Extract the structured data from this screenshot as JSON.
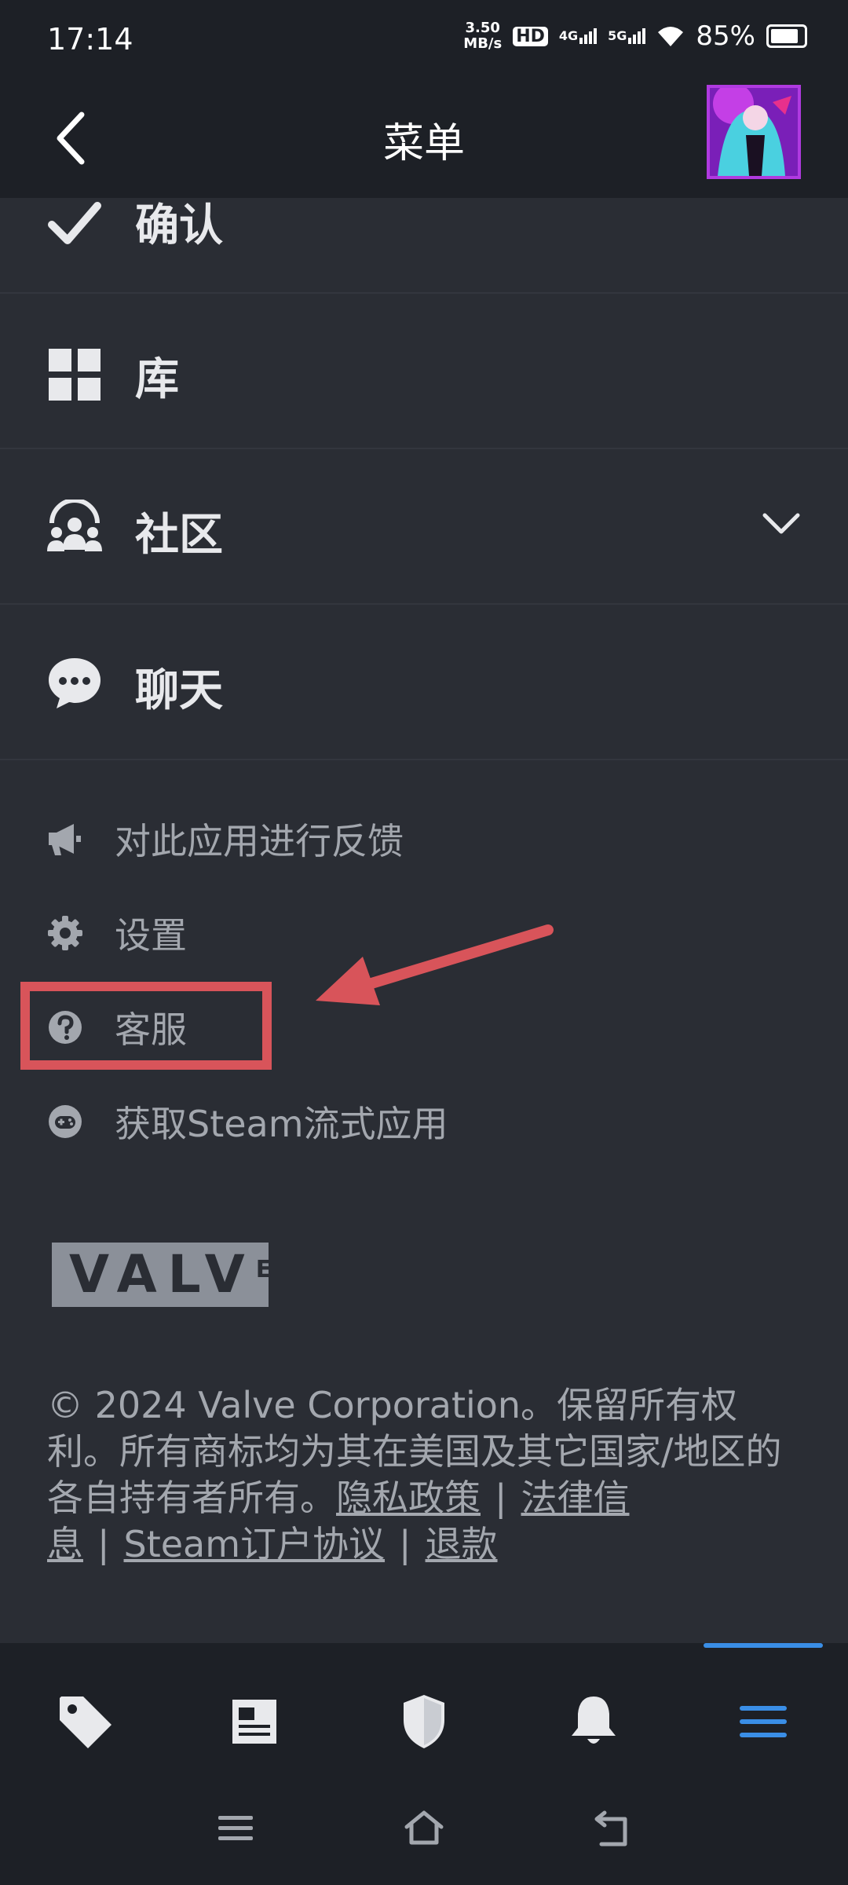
{
  "status_bar": {
    "time": "17:14",
    "net_speed_value": "3.50",
    "net_speed_unit": "MB/s",
    "hd_badge": "HD",
    "sim1_label": "4G",
    "sim2_label": "5G",
    "battery": "85%"
  },
  "header": {
    "title": "菜单",
    "back_icon": "chevron-left-icon",
    "avatar": "user-avatar"
  },
  "menu": {
    "items": [
      {
        "label": "确认",
        "icon": "check-icon"
      },
      {
        "label": "库",
        "icon": "grid-icon"
      },
      {
        "label": "社区",
        "icon": "community-icon",
        "expand_icon": "chevron-down-icon"
      },
      {
        "label": "聊天",
        "icon": "chat-bubble-icon"
      }
    ]
  },
  "secondary": {
    "items": [
      {
        "label": "对此应用进行反馈",
        "icon": "megaphone-icon"
      },
      {
        "label": "设置",
        "icon": "gear-icon"
      },
      {
        "label": "客服",
        "icon": "help-circle-icon"
      },
      {
        "label": "获取Steam流式应用",
        "icon": "gamepad-icon"
      }
    ]
  },
  "logo": {
    "text": "VALV",
    "superscript": "E"
  },
  "footer": {
    "copyright": "© 2024 Valve Corporation。保留所有权利。所有商标均为其在美国及其它国家/地区的各自持有者所有。",
    "privacy": "隐私政策",
    "legal": "法律信息",
    "ssa": "Steam订户协议",
    "refunds": "退款",
    "separator": "|"
  },
  "tabbar": {
    "items": [
      {
        "name": "store",
        "icon": "price-tag-icon"
      },
      {
        "name": "news",
        "icon": "newspaper-icon"
      },
      {
        "name": "guard",
        "icon": "shield-icon"
      },
      {
        "name": "notifications",
        "icon": "bell-icon"
      },
      {
        "name": "menu",
        "icon": "hamburger-icon",
        "active": true
      }
    ]
  },
  "colors": {
    "background": "#2a2d34",
    "header": "#1d2026",
    "accent": "#3a8ee6",
    "annotation": "#d8545a",
    "muted_text": "#a3a7ae"
  }
}
